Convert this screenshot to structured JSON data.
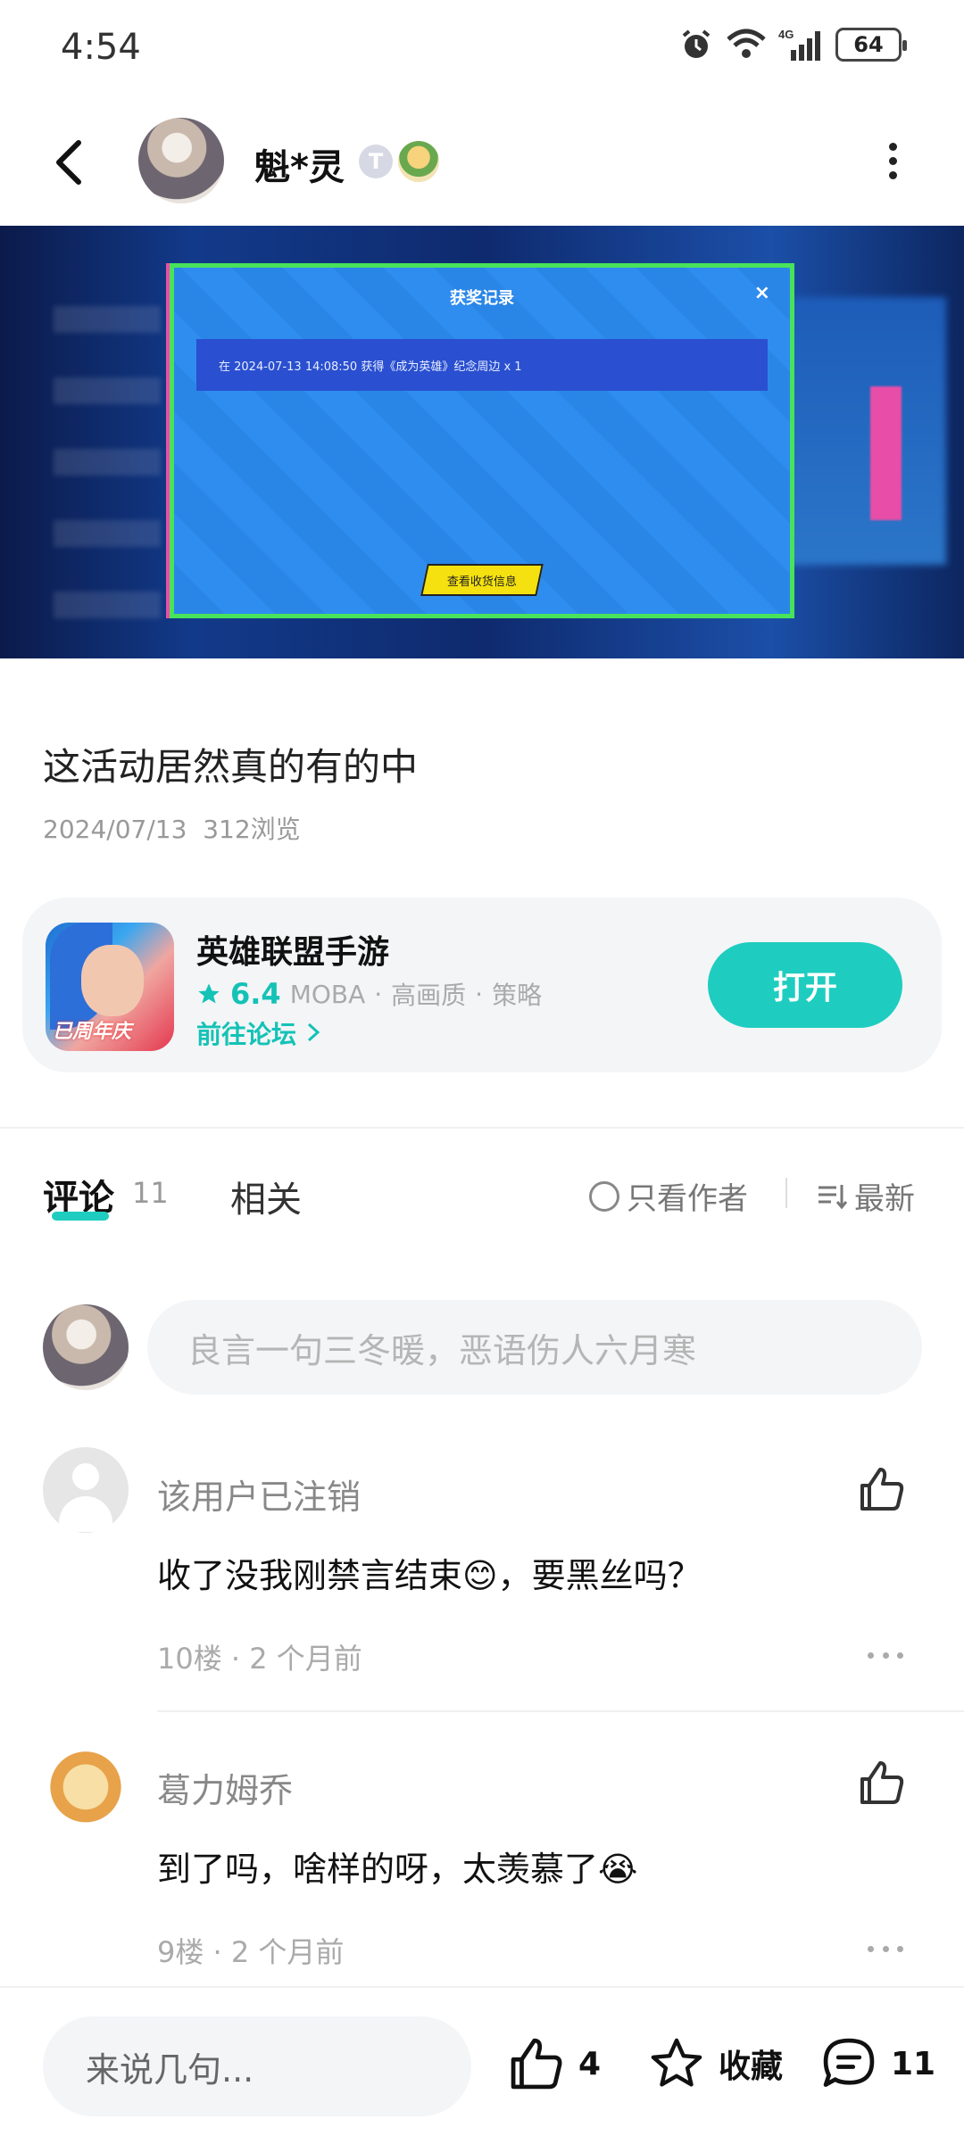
{
  "status_bar": {
    "time": "4:54",
    "battery": "64",
    "network": "4G"
  },
  "header": {
    "username": "魁*灵",
    "badge_letter": "T"
  },
  "screenshot": {
    "dialog_title": "获奖记录",
    "close": "×",
    "record": "在 2024-07-13 14:08:50 获得《成为英雄》纪念周边 x 1",
    "button": "查看收货信息"
  },
  "post": {
    "title": "这活动居然真的有的中",
    "date": "2024/07/13",
    "views": "312浏览"
  },
  "game_card": {
    "name": "英雄联盟手游",
    "score": "6.4",
    "tags": [
      "MOBA",
      "高画质",
      "策略"
    ],
    "forum_link": "前往论坛",
    "open_label": "打开",
    "icon_tag": "已周年庆"
  },
  "tabs": {
    "comments_label": "评论",
    "comments_count": "11",
    "related_label": "相关",
    "only_author": "只看作者",
    "sort": "最新"
  },
  "comment_input": {
    "placeholder": "良言一句三冬暖，恶语伤人六月寒"
  },
  "comments": [
    {
      "name": "该用户已注销",
      "text": "收了没我刚禁言结束😊，要黑丝吗？",
      "floor": "10楼",
      "time": "2 个月前"
    },
    {
      "name": "葛力姆乔",
      "text": "到了吗，啥样的呀，太羡慕了😭",
      "floor": "9楼",
      "time": "2 个月前"
    }
  ],
  "bottom_bar": {
    "input_placeholder": "来说几句...",
    "likes": "4",
    "favorite": "收藏",
    "comment_count": "11"
  },
  "colors": {
    "accent": "#1ecdbf",
    "text": "#111111",
    "muted": "#999999",
    "card_bg": "#f3f5f7"
  }
}
